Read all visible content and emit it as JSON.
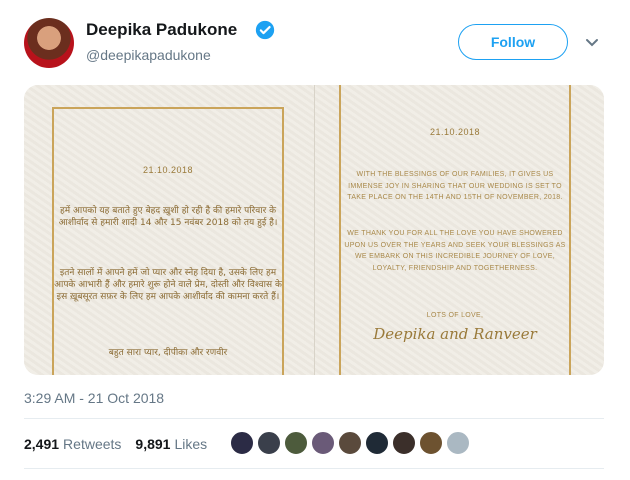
{
  "tweet": {
    "user": {
      "name": "Deepika Padukone",
      "handle": "@deepikapadukone",
      "verified": true,
      "avatar_icon": "profile-photo"
    },
    "follow_label": "Follow",
    "menu_icon": "chevron-down-icon",
    "image": {
      "left_card": {
        "date": "21.10.2018",
        "paragraph_1": "हमें आपको यह बताते हुए बेहद ख़ुशी हो रही है की हमारे परिवार के आशीर्वाद से हमारी शादी 14 और 15 नवंबर 2018 को तय हुई है।",
        "paragraph_2": "इतने सालों में आपने हमें जो प्यार और स्नेह दिया है, उसके लिए हम आपके आभारी हैं और हमारे शुरू होने वाले प्रेम, दोस्ती और विश्वास के इस ख़ूबसूरत सफ़र के लिए हम आपके आशीर्वाद की कामना करते हैं।",
        "paragraph_3": "बहुत सारा प्यार, दीपीका और रणवीर"
      },
      "right_card": {
        "date": "21.10.2018",
        "paragraph_1": "WITH THE BLESSINGS OF OUR FAMILIES, IT GIVES US IMMENSE JOY IN SHARING THAT OUR WEDDING IS SET TO TAKE PLACE ON THE 14TH AND 15TH OF NOVEMBER, 2018.",
        "paragraph_2": "WE THANK YOU FOR ALL THE LOVE YOU HAVE SHOWERED UPON US OVER THE YEARS AND SEEK YOUR BLESSINGS AS WE EMBARK ON THIS INCREDIBLE JOURNEY OF LOVE, LOYALTY, FRIENDSHIP AND TOGETHERNESS.",
        "paragraph_3": "LOTS OF LOVE,",
        "signature": "Deepika and Ranveer"
      }
    },
    "timestamp": "3:29 AM - 21 Oct 2018",
    "stats": {
      "retweets_count": "2,491",
      "retweets_label": "Retweets",
      "likes_count": "9,891",
      "likes_label": "Likes"
    },
    "likers": [
      "#2b2b45",
      "#3a3f4b",
      "#4d5b3c",
      "#6a5a78",
      "#5a4a3c",
      "#1f2a36",
      "#3b2f2a",
      "#6d5230",
      "#aab8c2"
    ],
    "colors": {
      "accent": "#1da1f2",
      "gold": "#c9a45a",
      "muted": "#657786"
    }
  }
}
